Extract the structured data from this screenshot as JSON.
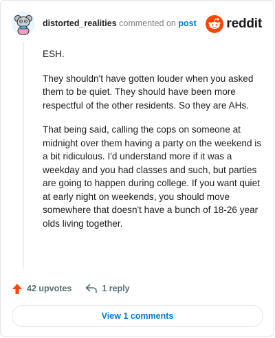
{
  "header": {
    "username": "distorted_realities",
    "action_text": "commented on",
    "post_link": "post",
    "brand": "reddit"
  },
  "comment": {
    "paragraphs": [
      "ESH.",
      "They shouldn't have gotten louder when you asked them to be quiet. They should have been more respectful of the other residents. So they are AHs.",
      "That being said, calling the cops on someone at midnight over them having a party on the weekend is a bit ridiculous. I'd understand more if it was a weekday and you had classes and such, but parties are going to happen during college. If you want quiet at early night on weekends, you should move somewhere that doesn't have a bunch of 18-26 year olds living together."
    ]
  },
  "actions": {
    "upvotes": "42 upvotes",
    "replies": "1 reply"
  },
  "view_comments_label": "View 1 comments",
  "colors": {
    "brand_orange": "#ff4500",
    "link_blue": "#0079d3",
    "upvote_orange": "#ff4500",
    "avatar_bg": "#e9f4fb"
  },
  "icons": {
    "avatar": "snoo-avatar-icon",
    "brand": "reddit-logo-icon",
    "upvote": "upvote-arrow-icon",
    "reply": "reply-arrow-icon"
  }
}
